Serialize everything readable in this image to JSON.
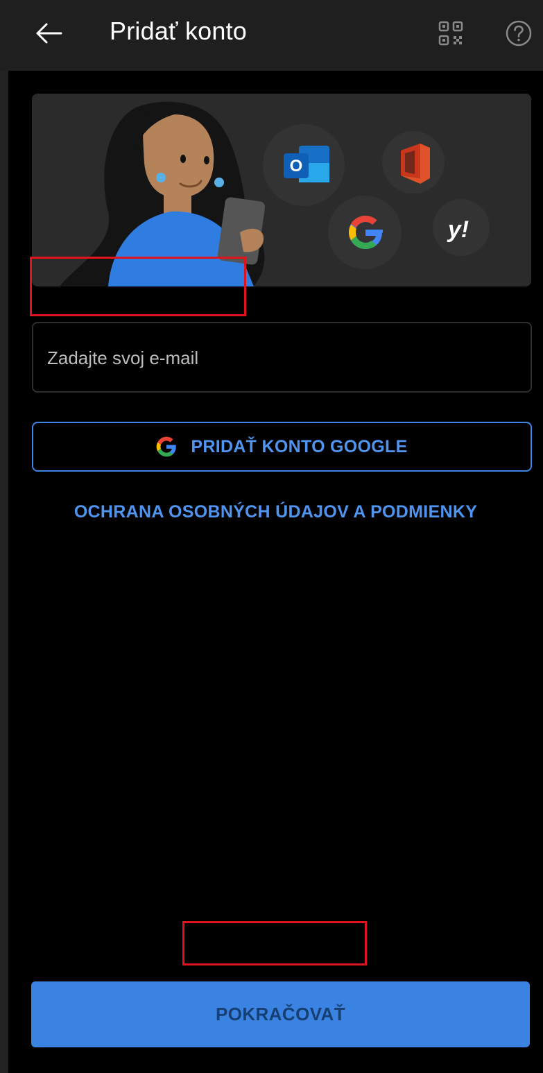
{
  "header": {
    "title": "Pridať konto",
    "back_icon": "arrow-left-icon",
    "qr_icon": "qr-code-icon",
    "help_icon": "help-circle-icon"
  },
  "banner": {
    "providers": [
      "outlook-logo",
      "office-logo",
      "google-logo",
      "yahoo-logo"
    ]
  },
  "email": {
    "placeholder": "Zadajte svoj e-mail",
    "value": ""
  },
  "google_button": {
    "label": "PRIDAŤ KONTO GOOGLE"
  },
  "privacy_link": {
    "label": "OCHRANA OSOBNÝCH ÚDAJOV A PODMIENKY"
  },
  "continue_button": {
    "label": "POKRAČOVAŤ"
  },
  "colors": {
    "accent": "#3b83e2",
    "link": "#4f95f0",
    "highlight": "#e0141c",
    "background": "#000000",
    "topbar": "#1f1f1f"
  }
}
